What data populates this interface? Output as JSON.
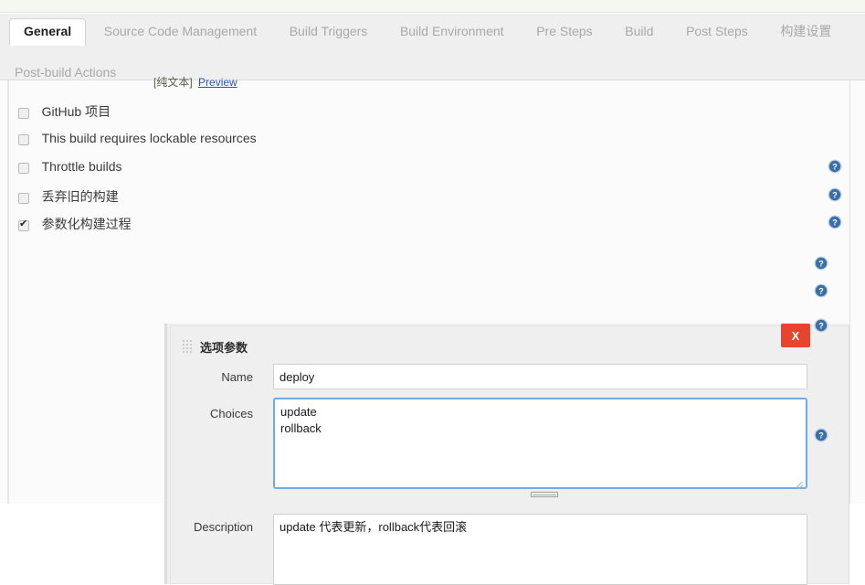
{
  "page": {
    "preview_plain_label": "[纯文本]",
    "preview_link": "Preview"
  },
  "tabs": {
    "row1": [
      {
        "label": "General",
        "active": true
      },
      {
        "label": "Source Code Management",
        "active": false
      },
      {
        "label": "Build Triggers",
        "active": false
      },
      {
        "label": "Build Environment",
        "active": false
      },
      {
        "label": "Pre Steps",
        "active": false
      },
      {
        "label": "Build",
        "active": false
      },
      {
        "label": "Post Steps",
        "active": false
      },
      {
        "label": "构建设置",
        "active": false
      }
    ],
    "row2": [
      {
        "label": "Post-build Actions",
        "active": false
      }
    ]
  },
  "options": [
    {
      "label": "GitHub 项目",
      "checked": false,
      "has_help": false
    },
    {
      "label": "This build requires lockable resources",
      "checked": false,
      "has_help": false
    },
    {
      "label": "Throttle builds",
      "checked": false,
      "has_help": true
    },
    {
      "label": "丢弃旧的构建",
      "checked": false,
      "has_help": true
    },
    {
      "label": "参数化构建过程",
      "checked": true,
      "has_help": true
    }
  ],
  "parameter": {
    "title": "选项参数",
    "delete_label": "X",
    "fields": {
      "name_label": "Name",
      "name_value": "deploy",
      "name_placeholder": "",
      "choices_label": "Choices",
      "choices_value": "update\nrollback",
      "choices_placeholder": "",
      "description_label": "Description",
      "description_value": "update 代表更新，rollback代表回滚",
      "description_placeholder": ""
    }
  },
  "icons": {
    "help": "help-icon",
    "grip": "drag-grip-icon",
    "close": "close-icon"
  },
  "colors": {
    "accent_blue": "#69aee6",
    "help_blue": "#3b6fa8",
    "delete_red": "#e8432c",
    "panel_grey": "#efefef",
    "top_strip": "#f3f8f1",
    "link_blue": "#2a58a8"
  }
}
